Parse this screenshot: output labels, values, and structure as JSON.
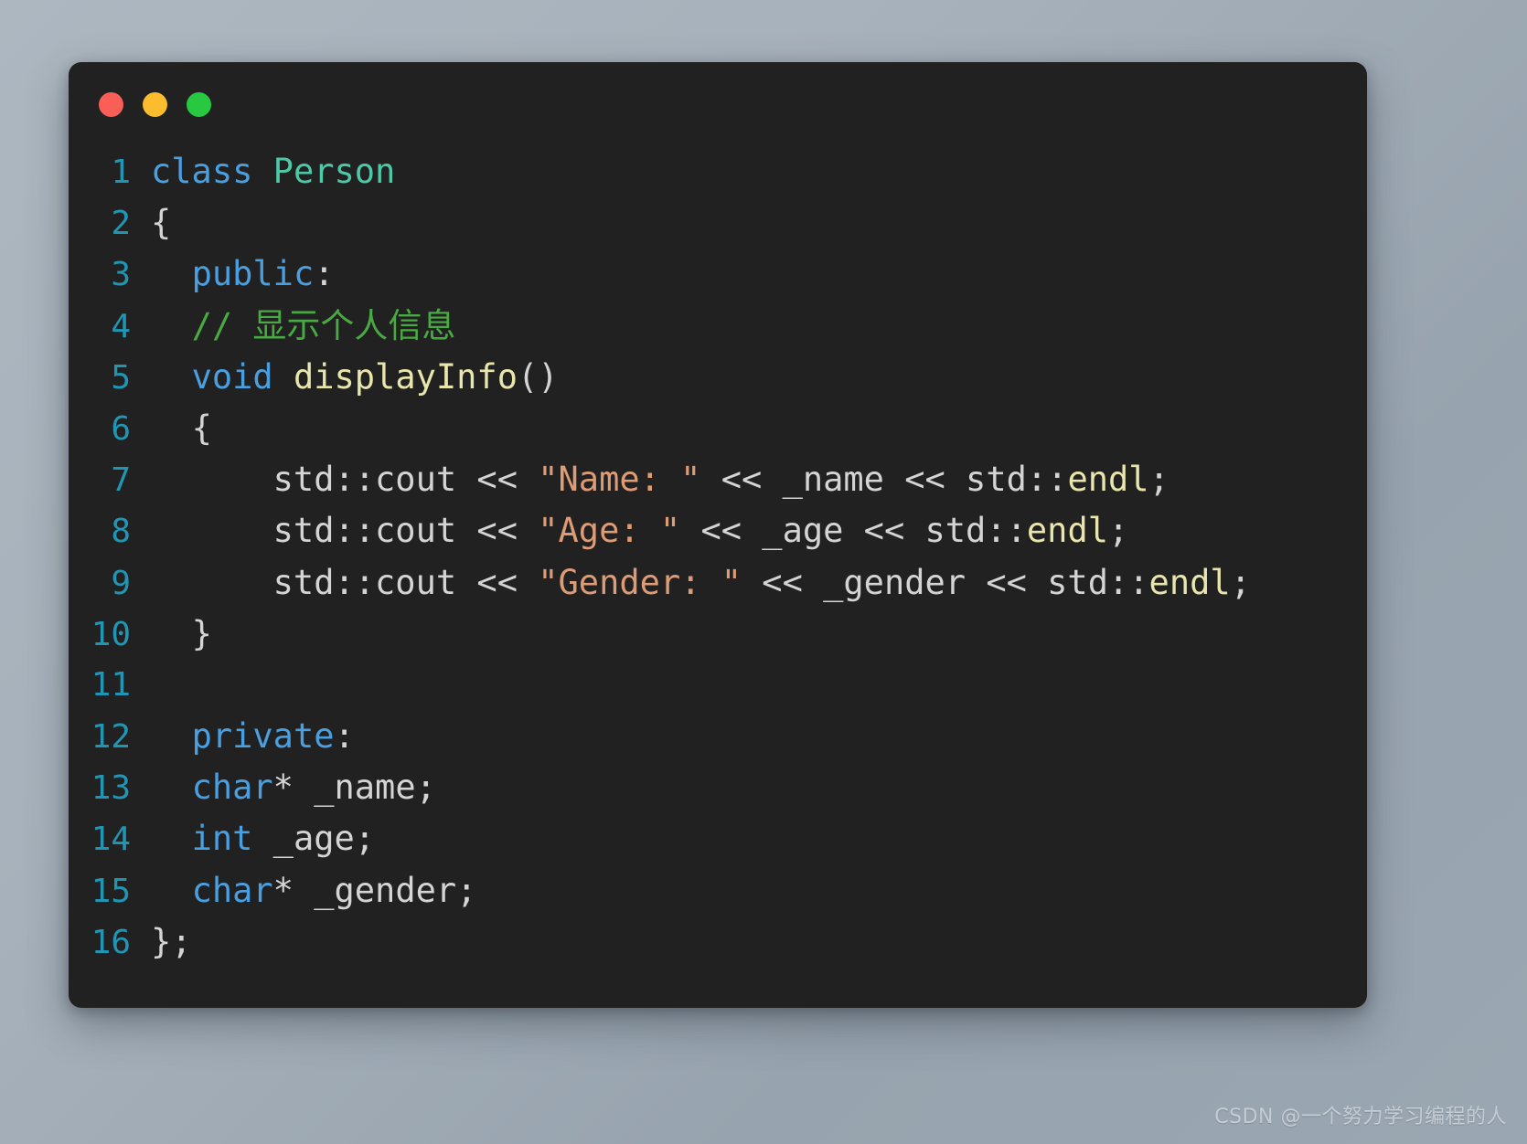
{
  "window": {
    "title": "",
    "traffic_lights": [
      {
        "name": "close",
        "color": "#fa5f57"
      },
      {
        "name": "minimize",
        "color": "#fbbd2e"
      },
      {
        "name": "maximize",
        "color": "#28c840"
      }
    ],
    "background_color": "#212121",
    "page_background": "#a7b1bb"
  },
  "editor": {
    "language": "C++",
    "line_count": 16,
    "lines": [
      {
        "number": "1",
        "text": "class Person"
      },
      {
        "number": "2",
        "text": "{"
      },
      {
        "number": "3",
        "text": "    public:"
      },
      {
        "number": "4",
        "text": "    // 显示个人信息"
      },
      {
        "number": "5",
        "text": "    void displayInfo()"
      },
      {
        "number": "6",
        "text": "    {"
      },
      {
        "number": "7",
        "text": "        std::cout << \"Name: \" << _name << std::endl;"
      },
      {
        "number": "8",
        "text": "        std::cout << \"Age: \" << _age << std::endl;"
      },
      {
        "number": "9",
        "text": "        std::cout << \"Gender: \" << _gender << std::endl;"
      },
      {
        "number": "10",
        "text": "    }"
      },
      {
        "number": "11",
        "text": ""
      },
      {
        "number": "12",
        "text": "    private:"
      },
      {
        "number": "13",
        "text": "    char* _name;"
      },
      {
        "number": "14",
        "text": "    int _age;"
      },
      {
        "number": "15",
        "text": "    char* _gender;"
      },
      {
        "number": "16",
        "text": "};"
      }
    ],
    "tokens": {
      "l1_kw": "class",
      "l1_sp": " ",
      "l1_type": "Person",
      "l2_brace": "{",
      "l3_indent": "  ",
      "l3_kw": "public",
      "l3_colon": ":",
      "l4_indent": "  ",
      "l4_comment": "// 显示个人信息",
      "l5_indent": "  ",
      "l5_kw": "void",
      "l5_sp": " ",
      "l5_fn": "displayInfo",
      "l5_parens": "()",
      "l6_indent": "  ",
      "l6_brace": "{",
      "l7_indent": "      ",
      "l7_a": "std::cout << ",
      "l7_str": "\"Name: \"",
      "l7_b": " << _name << std::",
      "l7_endl": "endl",
      "l7_semi": ";",
      "l8_indent": "      ",
      "l8_a": "std::cout << ",
      "l8_str": "\"Age: \"",
      "l8_b": " << _age << std::",
      "l8_endl": "endl",
      "l8_semi": ";",
      "l9_indent": "      ",
      "l9_a": "std::cout << ",
      "l9_str": "\"Gender: \"",
      "l9_b": " << _gender << std::",
      "l9_endl": "endl",
      "l9_semi": ";",
      "l10_indent": "  ",
      "l10_brace": "}",
      "l11_empty": "",
      "l12_indent": "  ",
      "l12_kw": "private",
      "l12_colon": ":",
      "l13_indent": "  ",
      "l13_kw": "char",
      "l13_star": "*",
      "l13_rest": " _name;",
      "l14_indent": "  ",
      "l14_kw": "int",
      "l14_rest": " _age;",
      "l15_indent": "  ",
      "l15_kw": "char",
      "l15_star": "*",
      "l15_rest": " _gender;",
      "l16_brace": "};"
    },
    "theme_colors": {
      "keyword": "#4a9fe0",
      "type": "#4ec9a7",
      "comment": "#49a942",
      "function": "#e8e6ac",
      "string": "#dd9b76",
      "plain": "#d4d4d4",
      "line_number": "#2196b4",
      "background": "#212121"
    }
  },
  "watermark": {
    "text": "CSDN @一个努力学习编程的人"
  }
}
